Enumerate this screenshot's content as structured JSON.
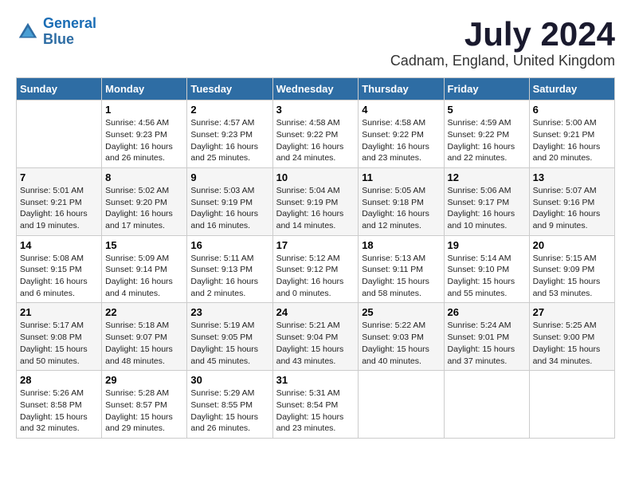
{
  "header": {
    "logo_line1": "General",
    "logo_line2": "Blue",
    "month_year": "July 2024",
    "location": "Cadnam, England, United Kingdom"
  },
  "days_of_week": [
    "Sunday",
    "Monday",
    "Tuesday",
    "Wednesday",
    "Thursday",
    "Friday",
    "Saturday"
  ],
  "weeks": [
    [
      {
        "day": "",
        "content": ""
      },
      {
        "day": "1",
        "content": "Sunrise: 4:56 AM\nSunset: 9:23 PM\nDaylight: 16 hours\nand 26 minutes."
      },
      {
        "day": "2",
        "content": "Sunrise: 4:57 AM\nSunset: 9:23 PM\nDaylight: 16 hours\nand 25 minutes."
      },
      {
        "day": "3",
        "content": "Sunrise: 4:58 AM\nSunset: 9:22 PM\nDaylight: 16 hours\nand 24 minutes."
      },
      {
        "day": "4",
        "content": "Sunrise: 4:58 AM\nSunset: 9:22 PM\nDaylight: 16 hours\nand 23 minutes."
      },
      {
        "day": "5",
        "content": "Sunrise: 4:59 AM\nSunset: 9:22 PM\nDaylight: 16 hours\nand 22 minutes."
      },
      {
        "day": "6",
        "content": "Sunrise: 5:00 AM\nSunset: 9:21 PM\nDaylight: 16 hours\nand 20 minutes."
      }
    ],
    [
      {
        "day": "7",
        "content": "Sunrise: 5:01 AM\nSunset: 9:21 PM\nDaylight: 16 hours\nand 19 minutes."
      },
      {
        "day": "8",
        "content": "Sunrise: 5:02 AM\nSunset: 9:20 PM\nDaylight: 16 hours\nand 17 minutes."
      },
      {
        "day": "9",
        "content": "Sunrise: 5:03 AM\nSunset: 9:19 PM\nDaylight: 16 hours\nand 16 minutes."
      },
      {
        "day": "10",
        "content": "Sunrise: 5:04 AM\nSunset: 9:19 PM\nDaylight: 16 hours\nand 14 minutes."
      },
      {
        "day": "11",
        "content": "Sunrise: 5:05 AM\nSunset: 9:18 PM\nDaylight: 16 hours\nand 12 minutes."
      },
      {
        "day": "12",
        "content": "Sunrise: 5:06 AM\nSunset: 9:17 PM\nDaylight: 16 hours\nand 10 minutes."
      },
      {
        "day": "13",
        "content": "Sunrise: 5:07 AM\nSunset: 9:16 PM\nDaylight: 16 hours\nand 9 minutes."
      }
    ],
    [
      {
        "day": "14",
        "content": "Sunrise: 5:08 AM\nSunset: 9:15 PM\nDaylight: 16 hours\nand 6 minutes."
      },
      {
        "day": "15",
        "content": "Sunrise: 5:09 AM\nSunset: 9:14 PM\nDaylight: 16 hours\nand 4 minutes."
      },
      {
        "day": "16",
        "content": "Sunrise: 5:11 AM\nSunset: 9:13 PM\nDaylight: 16 hours\nand 2 minutes."
      },
      {
        "day": "17",
        "content": "Sunrise: 5:12 AM\nSunset: 9:12 PM\nDaylight: 16 hours\nand 0 minutes."
      },
      {
        "day": "18",
        "content": "Sunrise: 5:13 AM\nSunset: 9:11 PM\nDaylight: 15 hours\nand 58 minutes."
      },
      {
        "day": "19",
        "content": "Sunrise: 5:14 AM\nSunset: 9:10 PM\nDaylight: 15 hours\nand 55 minutes."
      },
      {
        "day": "20",
        "content": "Sunrise: 5:15 AM\nSunset: 9:09 PM\nDaylight: 15 hours\nand 53 minutes."
      }
    ],
    [
      {
        "day": "21",
        "content": "Sunrise: 5:17 AM\nSunset: 9:08 PM\nDaylight: 15 hours\nand 50 minutes."
      },
      {
        "day": "22",
        "content": "Sunrise: 5:18 AM\nSunset: 9:07 PM\nDaylight: 15 hours\nand 48 minutes."
      },
      {
        "day": "23",
        "content": "Sunrise: 5:19 AM\nSunset: 9:05 PM\nDaylight: 15 hours\nand 45 minutes."
      },
      {
        "day": "24",
        "content": "Sunrise: 5:21 AM\nSunset: 9:04 PM\nDaylight: 15 hours\nand 43 minutes."
      },
      {
        "day": "25",
        "content": "Sunrise: 5:22 AM\nSunset: 9:03 PM\nDaylight: 15 hours\nand 40 minutes."
      },
      {
        "day": "26",
        "content": "Sunrise: 5:24 AM\nSunset: 9:01 PM\nDaylight: 15 hours\nand 37 minutes."
      },
      {
        "day": "27",
        "content": "Sunrise: 5:25 AM\nSunset: 9:00 PM\nDaylight: 15 hours\nand 34 minutes."
      }
    ],
    [
      {
        "day": "28",
        "content": "Sunrise: 5:26 AM\nSunset: 8:58 PM\nDaylight: 15 hours\nand 32 minutes."
      },
      {
        "day": "29",
        "content": "Sunrise: 5:28 AM\nSunset: 8:57 PM\nDaylight: 15 hours\nand 29 minutes."
      },
      {
        "day": "30",
        "content": "Sunrise: 5:29 AM\nSunset: 8:55 PM\nDaylight: 15 hours\nand 26 minutes."
      },
      {
        "day": "31",
        "content": "Sunrise: 5:31 AM\nSunset: 8:54 PM\nDaylight: 15 hours\nand 23 minutes."
      },
      {
        "day": "",
        "content": ""
      },
      {
        "day": "",
        "content": ""
      },
      {
        "day": "",
        "content": ""
      }
    ]
  ]
}
